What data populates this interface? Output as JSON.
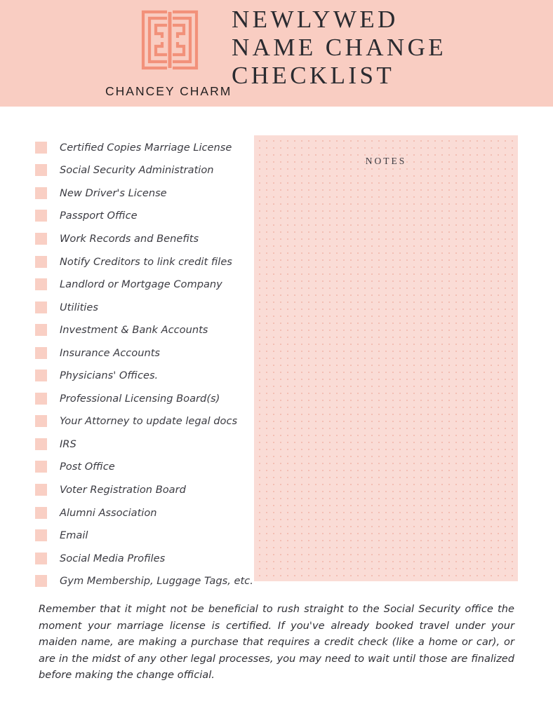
{
  "page": {
    "background_color": "#ffffff",
    "header_band_color": "#f9cdc2",
    "accent_color": "#f2917a",
    "checkbox_color": "#f9cfc4",
    "notes_panel_color": "#fadcd6",
    "notes_dot_color": "#f3bdb2",
    "text_color": "#2f2f35"
  },
  "header": {
    "brand_name": "CHANCEY CHARM",
    "logo_name": "chancey-charm-greek-key-monogram",
    "title_lines": [
      "NEWLYWED",
      "NAME CHANGE",
      "CHECKLIST"
    ]
  },
  "checklist": {
    "items": [
      {
        "label": "Certified Copies Marriage License",
        "checked": false
      },
      {
        "label": "Social Security Administration",
        "checked": false
      },
      {
        "label": "New Driver's License",
        "checked": false
      },
      {
        "label": "Passport Office",
        "checked": false
      },
      {
        "label": "Work Records and Benefits",
        "checked": false
      },
      {
        "label": "Notify Creditors to link credit files",
        "checked": false
      },
      {
        "label": "Landlord or Mortgage Company",
        "checked": false
      },
      {
        "label": "Utilities",
        "checked": false
      },
      {
        "label": "Investment & Bank Accounts",
        "checked": false
      },
      {
        "label": "Insurance Accounts",
        "checked": false
      },
      {
        "label": "Physicians' Offices.",
        "checked": false
      },
      {
        "label": "Professional Licensing Board(s)",
        "checked": false
      },
      {
        "label": "Your Attorney to update legal docs",
        "checked": false
      },
      {
        "label": "IRS",
        "checked": false
      },
      {
        "label": "Post Office",
        "checked": false
      },
      {
        "label": "Voter Registration Board",
        "checked": false
      },
      {
        "label": "Alumni Association",
        "checked": false
      },
      {
        "label": "Email",
        "checked": false
      },
      {
        "label": "Social Media Profiles",
        "checked": false
      },
      {
        "label": "Gym Membership, Luggage Tags, etc.",
        "checked": false
      }
    ]
  },
  "notes": {
    "title": "NOTES",
    "value": ""
  },
  "footnote": {
    "text": "Remember that it might not be beneficial to rush straight to the Social Security office the moment your marriage license is certified. If you've already booked travel under your maiden name, are making a purchase that requires a credit check (like a home or car), or are in the midst of any other legal processes, you may need to wait until those are finalized before making the change official."
  }
}
